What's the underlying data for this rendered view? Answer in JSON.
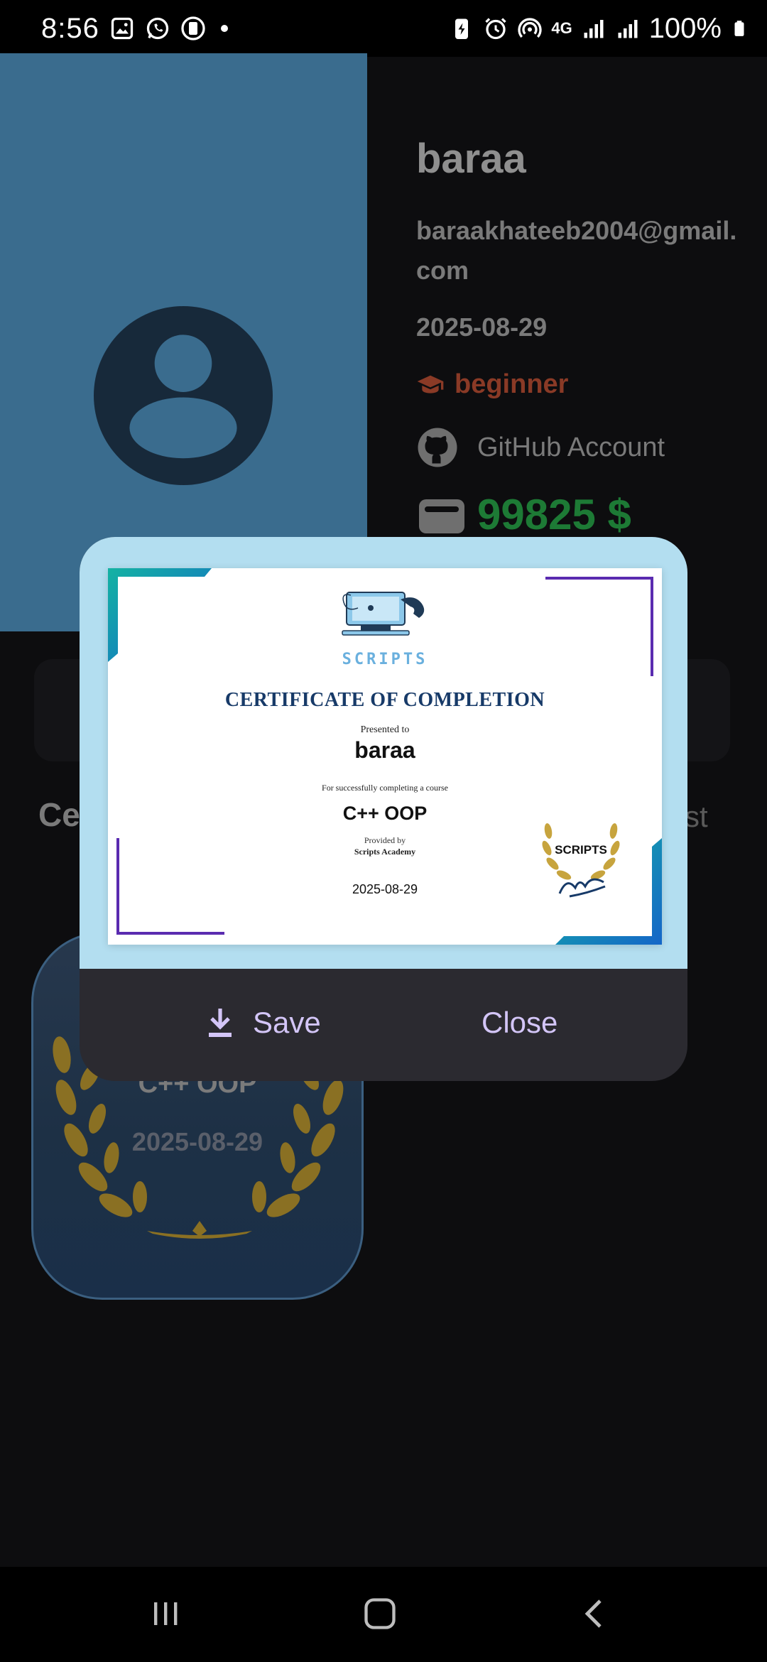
{
  "status_bar": {
    "time": "8:56",
    "network": "4G",
    "battery": "100%"
  },
  "profile": {
    "name": "baraa",
    "email": "baraakhateeb2004@gmail.com",
    "date": "2025-08-29",
    "level": "beginner",
    "github": "GitHub Account",
    "balance": "99825 $"
  },
  "background_tabs": {
    "left_label": "Ce",
    "right_label": "st"
  },
  "certificate_card": {
    "title": "C++ OOP",
    "date": "2025-08-29"
  },
  "dialog": {
    "certificate": {
      "brand": "SCRIPTS",
      "heading": "CERTIFICATE OF COMPLETION",
      "presented_to": "Presented to",
      "recipient": "baraa",
      "for_text": "For successfully completing a course",
      "course": "C++ OOP",
      "provided_by": "Provided by",
      "provider": "Scripts Academy",
      "date": "2025-08-29",
      "seal_text": "SCRIPTS"
    },
    "save_label": "Save",
    "close_label": "Close"
  },
  "colors": {
    "avatar_panel": "#3a6c8e",
    "dialog_top": "#b3def0",
    "dialog_bottom": "#2b2a30",
    "accent_button": "#d3c5f7",
    "balance": "#1d7a35",
    "level": "#8a3a26"
  }
}
